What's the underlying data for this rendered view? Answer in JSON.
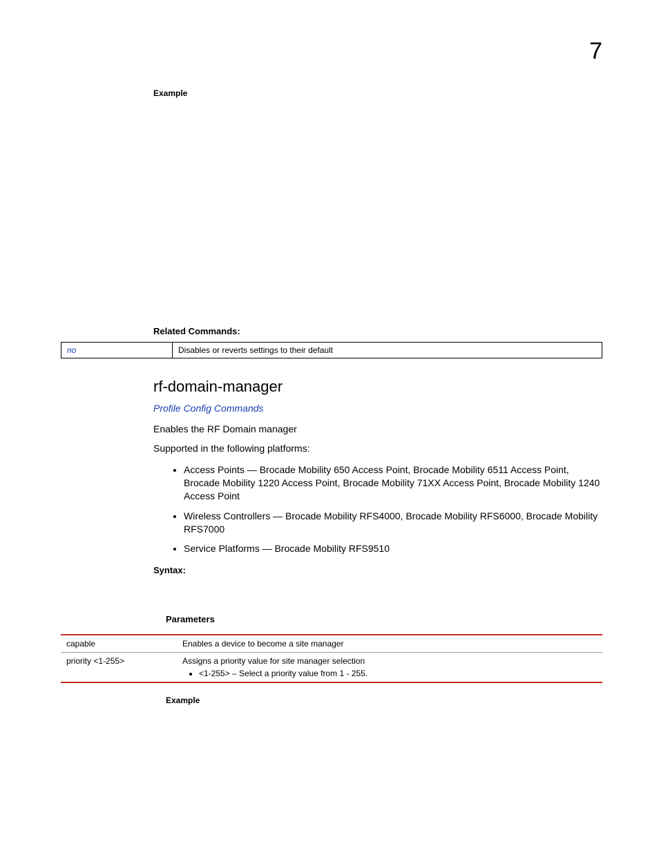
{
  "pageNumber": "7",
  "exampleLabelTop": "Example",
  "relatedHeading": "Related Commands:",
  "relatedTable": {
    "left": "no",
    "right": "Disables or reverts settings to their default"
  },
  "cmdHeading": "rf-domain-manager",
  "link": "Profile Config Commands",
  "intro1": "Enables the RF Domain manager",
  "intro2": "Supported in the following platforms:",
  "platforms": {
    "ap": "Access Points — Brocade Mobility 650 Access Point, Brocade Mobility 6511 Access Point, Brocade Mobility 1220 Access Point, Brocade Mobility 71XX Access Point, Brocade Mobility 1240 Access Point",
    "wc": "Wireless Controllers — Brocade Mobility RFS4000, Brocade Mobility RFS6000, Brocade Mobility RFS7000",
    "sp": "Service Platforms — Brocade Mobility RFS9510"
  },
  "syntaxLabel": "Syntax:",
  "paramsLabel": "Parameters",
  "paramsTable": {
    "row1": {
      "left": "capable",
      "right": "Enables a device to become a site manager"
    },
    "row2": {
      "left": "priority <1-255>",
      "right": "Assigns a priority value for site manager selection",
      "bullet": "<1-255> – Select a priority value from 1 - 255."
    }
  },
  "exampleLabelBottom": "Example"
}
